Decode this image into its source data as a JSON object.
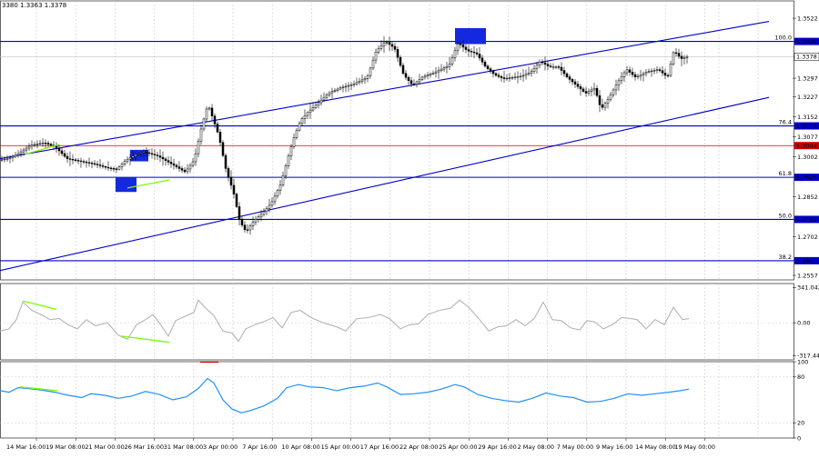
{
  "header": {
    "ohlc_text": "3380 1.3363 1.3378"
  },
  "colors": {
    "candle": "#000000",
    "channel": "#0000cc",
    "level": "#0000cc",
    "current_line": "#c0c0c0",
    "red_level": "#cc0000",
    "cci_line": "#b4b4b4",
    "rsi_line": "#1e90ff",
    "divergence": "#7cfc00",
    "box": "#1428e0",
    "grid": "#c8c8c8",
    "label_bg_blue": "#0000cc",
    "label_bg_red": "#cc0000",
    "label_bg_current": "#ffffff"
  },
  "chart_data": [
    {
      "type": "candlestick",
      "title": "",
      "price_axis_ticks": [
        "1.3522",
        "1.3435",
        "1.3378",
        "1.3297",
        "1.3227",
        "1.3152",
        "1.3118",
        "1.3077",
        "1.3044",
        "1.3002",
        "1.2925",
        "1.2852",
        "1.2767",
        "1.2702",
        "1.2612",
        "1.2557"
      ],
      "ylim": [
        1.254,
        1.357
      ],
      "current_price": 1.3378,
      "levels": [
        {
          "fib": "100.0",
          "price": 1.3435,
          "label": "1.3435",
          "color": "blue"
        },
        {
          "fib": "76.4",
          "price": 1.3118,
          "label": "1.3118",
          "color": "blue"
        },
        {
          "fib": "",
          "price": 1.3044,
          "label": "1.3044",
          "color": "red"
        },
        {
          "fib": "61.8",
          "price": 1.2925,
          "label": "1.2925",
          "color": "blue"
        },
        {
          "fib": "50.0",
          "price": 1.2767,
          "label": "1.2767",
          "color": "blue"
        },
        {
          "fib": "38.2",
          "price": 1.2612,
          "label": "1.2612",
          "color": "blue"
        }
      ],
      "x_labels": [
        "14 Mar 16:00",
        "19 Mar 08:00",
        "21 Mar 00:00",
        "26 Mar 16:00",
        "31 Mar 08:00",
        "3 Apr 00:00",
        "7 Apr 16:00",
        "10 Apr 08:00",
        "15 Apr 00:00",
        "17 Apr 16:00",
        "22 Apr 08:00",
        "25 Apr 00:00",
        "29 Apr 16:00",
        "2 May 08:00",
        "7 May 00:00",
        "9 May 16:00",
        "14 May 08:00",
        "19 May 00:00"
      ],
      "price_path": [
        [
          0,
          1.299
        ],
        [
          10,
          1.2995
        ],
        [
          20,
          1.301
        ],
        [
          35,
          1.3045
        ],
        [
          50,
          1.3055
        ],
        [
          62,
          1.304
        ],
        [
          75,
          1.2995
        ],
        [
          90,
          1.2985
        ],
        [
          105,
          1.2975
        ],
        [
          120,
          1.296
        ],
        [
          130,
          1.2955
        ],
        [
          140,
          1.299
        ],
        [
          150,
          1.301
        ],
        [
          160,
          1.302
        ],
        [
          175,
          1.3005
        ],
        [
          190,
          1.2975
        ],
        [
          205,
          1.2945
        ],
        [
          215,
          1.299
        ],
        [
          222,
          1.31
        ],
        [
          230,
          1.32
        ],
        [
          236,
          1.314
        ],
        [
          242,
          1.308
        ],
        [
          250,
          1.295
        ],
        [
          258,
          1.287
        ],
        [
          265,
          1.276
        ],
        [
          272,
          1.272
        ],
        [
          280,
          1.276
        ],
        [
          290,
          1.279
        ],
        [
          300,
          1.283
        ],
        [
          310,
          1.29
        ],
        [
          318,
          1.3
        ],
        [
          325,
          1.308
        ],
        [
          332,
          1.314
        ],
        [
          340,
          1.317
        ],
        [
          350,
          1.32
        ],
        [
          362,
          1.324
        ],
        [
          375,
          1.326
        ],
        [
          390,
          1.3275
        ],
        [
          405,
          1.33
        ],
        [
          415,
          1.34
        ],
        [
          425,
          1.3435
        ],
        [
          435,
          1.341
        ],
        [
          445,
          1.331
        ],
        [
          455,
          1.327
        ],
        [
          465,
          1.33
        ],
        [
          480,
          1.332
        ],
        [
          495,
          1.3345
        ],
        [
          505,
          1.343
        ],
        [
          515,
          1.34
        ],
        [
          525,
          1.339
        ],
        [
          535,
          1.334
        ],
        [
          545,
          1.331
        ],
        [
          555,
          1.3295
        ],
        [
          565,
          1.33
        ],
        [
          575,
          1.3305
        ],
        [
          585,
          1.332
        ],
        [
          595,
          1.336
        ],
        [
          605,
          1.334
        ],
        [
          615,
          1.334
        ],
        [
          625,
          1.33
        ],
        [
          635,
          1.327
        ],
        [
          645,
          1.324
        ],
        [
          655,
          1.326
        ],
        [
          662,
          1.318
        ],
        [
          670,
          1.322
        ],
        [
          680,
          1.328
        ],
        [
          690,
          1.333
        ],
        [
          700,
          1.33
        ],
        [
          712,
          1.332
        ],
        [
          725,
          1.333
        ],
        [
          735,
          1.33
        ],
        [
          742,
          1.34
        ],
        [
          750,
          1.337
        ],
        [
          757,
          1.3378
        ]
      ],
      "channel_upper": {
        "x1": 0,
        "y1": 1.2995,
        "x2": 845,
        "y2": 1.351
      },
      "channel_lower": {
        "x1": 0,
        "y1": 1.2575,
        "x2": 845,
        "y2": 1.3225
      },
      "divergence_lines": [
        {
          "x1": 28,
          "y1": 1.3012,
          "x2": 65,
          "y2": 1.3048
        },
        {
          "x1": 140,
          "y1": 1.2885,
          "x2": 186,
          "y2": 1.2915
        }
      ],
      "boxes": [
        {
          "x1": 143,
          "y1": 1.3028,
          "x2": 163,
          "y2": 1.2985
        },
        {
          "x1": 127,
          "y1": 1.2925,
          "x2": 150,
          "y2": 1.287
        },
        {
          "x1": 500,
          "y1": 1.3485,
          "x2": 534,
          "y2": 1.3425
        }
      ]
    },
    {
      "type": "line",
      "title": "",
      "name": "CCI",
      "ticks": [
        "341.0423",
        "0.00",
        "-317.444"
      ],
      "ylim": [
        -360,
        380
      ],
      "values": [
        [
          0,
          -80
        ],
        [
          10,
          -60
        ],
        [
          18,
          30
        ],
        [
          25,
          200
        ],
        [
          35,
          120
        ],
        [
          45,
          80
        ],
        [
          55,
          30
        ],
        [
          65,
          40
        ],
        [
          75,
          -20
        ],
        [
          85,
          -60
        ],
        [
          95,
          30
        ],
        [
          105,
          -30
        ],
        [
          118,
          0
        ],
        [
          130,
          -120
        ],
        [
          140,
          -160
        ],
        [
          150,
          -20
        ],
        [
          160,
          30
        ],
        [
          168,
          80
        ],
        [
          175,
          0
        ],
        [
          185,
          -130
        ],
        [
          193,
          20
        ],
        [
          203,
          60
        ],
        [
          213,
          100
        ],
        [
          218,
          220
        ],
        [
          225,
          150
        ],
        [
          235,
          70
        ],
        [
          245,
          -80
        ],
        [
          255,
          -100
        ],
        [
          262,
          -180
        ],
        [
          270,
          -60
        ],
        [
          280,
          -20
        ],
        [
          290,
          10
        ],
        [
          300,
          50
        ],
        [
          310,
          -50
        ],
        [
          320,
          100
        ],
        [
          330,
          120
        ],
        [
          342,
          50
        ],
        [
          355,
          0
        ],
        [
          370,
          -40
        ],
        [
          380,
          -80
        ],
        [
          392,
          40
        ],
        [
          405,
          50
        ],
        [
          418,
          80
        ],
        [
          428,
          40
        ],
        [
          440,
          -60
        ],
        [
          450,
          -20
        ],
        [
          460,
          -10
        ],
        [
          470,
          80
        ],
        [
          483,
          120
        ],
        [
          495,
          140
        ],
        [
          505,
          220
        ],
        [
          515,
          150
        ],
        [
          527,
          30
        ],
        [
          537,
          -80
        ],
        [
          547,
          -40
        ],
        [
          557,
          -30
        ],
        [
          567,
          30
        ],
        [
          577,
          -30
        ],
        [
          587,
          40
        ],
        [
          597,
          200
        ],
        [
          607,
          30
        ],
        [
          617,
          20
        ],
        [
          627,
          -50
        ],
        [
          637,
          -70
        ],
        [
          645,
          20
        ],
        [
          653,
          10
        ],
        [
          663,
          -60
        ],
        [
          673,
          -20
        ],
        [
          683,
          50
        ],
        [
          693,
          40
        ],
        [
          700,
          30
        ],
        [
          710,
          -60
        ],
        [
          720,
          30
        ],
        [
          730,
          -20
        ],
        [
          740,
          150
        ],
        [
          750,
          30
        ],
        [
          757,
          40
        ]
      ]
    },
    {
      "type": "line",
      "title": "",
      "name": "RSI",
      "ticks": [
        "100",
        "80",
        "20",
        "0"
      ],
      "ylim": [
        0,
        100
      ],
      "values": [
        [
          0,
          62
        ],
        [
          10,
          60
        ],
        [
          20,
          66
        ],
        [
          30,
          65
        ],
        [
          45,
          63
        ],
        [
          60,
          60
        ],
        [
          75,
          56
        ],
        [
          90,
          53
        ],
        [
          100,
          58
        ],
        [
          115,
          56
        ],
        [
          130,
          52
        ],
        [
          145,
          55
        ],
        [
          160,
          61
        ],
        [
          175,
          57
        ],
        [
          190,
          50
        ],
        [
          205,
          54
        ],
        [
          218,
          65
        ],
        [
          228,
          78
        ],
        [
          235,
          72
        ],
        [
          245,
          50
        ],
        [
          255,
          38
        ],
        [
          265,
          33
        ],
        [
          275,
          36
        ],
        [
          290,
          42
        ],
        [
          305,
          52
        ],
        [
          315,
          66
        ],
        [
          328,
          70
        ],
        [
          340,
          67
        ],
        [
          355,
          66
        ],
        [
          370,
          62
        ],
        [
          385,
          66
        ],
        [
          400,
          68
        ],
        [
          415,
          72
        ],
        [
          425,
          67
        ],
        [
          440,
          57
        ],
        [
          455,
          58
        ],
        [
          470,
          60
        ],
        [
          485,
          64
        ],
        [
          500,
          70
        ],
        [
          510,
          67
        ],
        [
          525,
          57
        ],
        [
          540,
          52
        ],
        [
          555,
          49
        ],
        [
          570,
          47
        ],
        [
          585,
          52
        ],
        [
          600,
          59
        ],
        [
          615,
          55
        ],
        [
          630,
          53
        ],
        [
          645,
          47
        ],
        [
          660,
          48
        ],
        [
          675,
          52
        ],
        [
          690,
          58
        ],
        [
          705,
          56
        ],
        [
          720,
          58
        ],
        [
          735,
          60
        ],
        [
          748,
          62
        ],
        [
          757,
          64
        ]
      ],
      "divergence_line": {
        "x1": 22,
        "y1": 67,
        "x2": 63,
        "y2": 62
      },
      "red_marker": {
        "x1": 220,
        "x2": 240,
        "y": 102
      }
    }
  ]
}
